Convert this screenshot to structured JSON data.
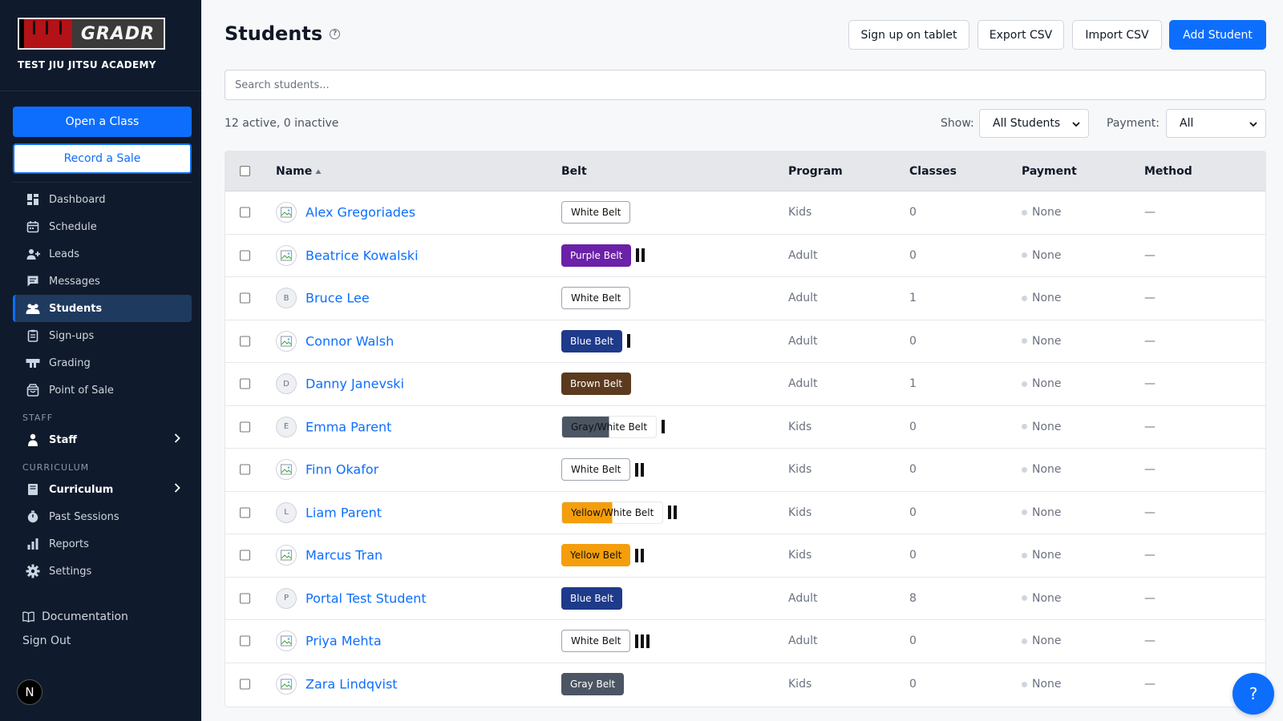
{
  "brand": {
    "logo_text": "GRADR",
    "academy": "TEST JIU JITSU ACADEMY"
  },
  "sidebar": {
    "open_class": "Open a Class",
    "record_sale": "Record a Sale",
    "items": [
      {
        "label": "Dashboard",
        "icon": "dashboard-icon"
      },
      {
        "label": "Schedule",
        "icon": "calendar-icon"
      },
      {
        "label": "Leads",
        "icon": "person-add-icon"
      },
      {
        "label": "Messages",
        "icon": "message-icon"
      },
      {
        "label": "Students",
        "icon": "students-icon",
        "active": true
      },
      {
        "label": "Sign-ups",
        "icon": "clipboard-icon"
      },
      {
        "label": "Grading",
        "icon": "grading-icon"
      },
      {
        "label": "Point of Sale",
        "icon": "shopping-bag-icon"
      }
    ],
    "staff_section": "STAFF",
    "staff_item": "Staff",
    "curriculum_section": "CURRICULUM",
    "curriculum_items": [
      {
        "label": "Curriculum",
        "icon": "book-icon"
      },
      {
        "label": "Past Sessions",
        "icon": "stopwatch-icon"
      },
      {
        "label": "Reports",
        "icon": "bar-chart-icon"
      },
      {
        "label": "Settings",
        "icon": "gear-icon"
      }
    ],
    "documentation": "Documentation",
    "sign_out": "Sign Out",
    "user_initial": "N"
  },
  "header": {
    "title": "Students",
    "buttons": {
      "tablet": "Sign up on tablet",
      "export": "Export CSV",
      "import": "Import CSV",
      "add": "Add Student"
    }
  },
  "search": {
    "placeholder": "Search students..."
  },
  "filters": {
    "counts": "12 active, 0 inactive",
    "show_label": "Show:",
    "show_value": "All Students",
    "payment_label": "Payment:",
    "payment_value": "All"
  },
  "table": {
    "columns": {
      "name": "Name",
      "belt": "Belt",
      "program": "Program",
      "classes": "Classes",
      "payment": "Payment",
      "method": "Method"
    },
    "rows": [
      {
        "name": "Alex Gregoriades",
        "initial": "",
        "belt": "White Belt",
        "belt_style": "white",
        "stripes": 0,
        "program": "Kids",
        "classes": "0",
        "payment": "None",
        "method": "—"
      },
      {
        "name": "Beatrice Kowalski",
        "initial": "",
        "belt": "Purple Belt",
        "belt_style": "purple",
        "stripes": 2,
        "program": "Adult",
        "classes": "0",
        "payment": "None",
        "method": "—"
      },
      {
        "name": "Bruce Lee",
        "initial": "B",
        "belt": "White Belt",
        "belt_style": "white",
        "stripes": 0,
        "program": "Adult",
        "classes": "1",
        "payment": "None",
        "method": "—"
      },
      {
        "name": "Connor Walsh",
        "initial": "",
        "belt": "Blue Belt",
        "belt_style": "blue",
        "stripes": 1,
        "program": "Adult",
        "classes": "0",
        "payment": "None",
        "method": "—"
      },
      {
        "name": "Danny Janevski",
        "initial": "D",
        "belt": "Brown Belt",
        "belt_style": "brown",
        "stripes": 0,
        "program": "Adult",
        "classes": "1",
        "payment": "None",
        "method": "—"
      },
      {
        "name": "Emma Parent",
        "initial": "E",
        "belt": "Gray/White Belt",
        "belt_style": "gray-white",
        "stripes": 1,
        "program": "Kids",
        "classes": "0",
        "payment": "None",
        "method": "—"
      },
      {
        "name": "Finn Okafor",
        "initial": "",
        "belt": "White Belt",
        "belt_style": "white",
        "stripes": 2,
        "program": "Kids",
        "classes": "0",
        "payment": "None",
        "method": "—"
      },
      {
        "name": "Liam Parent",
        "initial": "L",
        "belt": "Yellow/White Belt",
        "belt_style": "yellow-white",
        "stripes": 2,
        "program": "Kids",
        "classes": "0",
        "payment": "None",
        "method": "—"
      },
      {
        "name": "Marcus Tran",
        "initial": "",
        "belt": "Yellow Belt",
        "belt_style": "yellow",
        "stripes": 2,
        "program": "Kids",
        "classes": "0",
        "payment": "None",
        "method": "—"
      },
      {
        "name": "Portal Test Student",
        "initial": "P",
        "belt": "Blue Belt",
        "belt_style": "blue",
        "stripes": 0,
        "program": "Adult",
        "classes": "8",
        "payment": "None",
        "method": "—"
      },
      {
        "name": "Priya Mehta",
        "initial": "",
        "belt": "White Belt",
        "belt_style": "white",
        "stripes": 3,
        "program": "Adult",
        "classes": "0",
        "payment": "None",
        "method": "—"
      },
      {
        "name": "Zara Lindqvist",
        "initial": "",
        "belt": "Gray Belt",
        "belt_style": "gray",
        "stripes": 0,
        "program": "Kids",
        "classes": "0",
        "payment": "None",
        "method": "—"
      }
    ]
  },
  "help_button": "?",
  "colors": {
    "primary": "#0d6efd",
    "sidebar_bg": "#0f1b2d",
    "purple": "#6b21a8",
    "blue": "#1e3a8a",
    "brown": "#5b3a1e",
    "yellow": "#f59e0b",
    "gray": "#4b5563"
  }
}
